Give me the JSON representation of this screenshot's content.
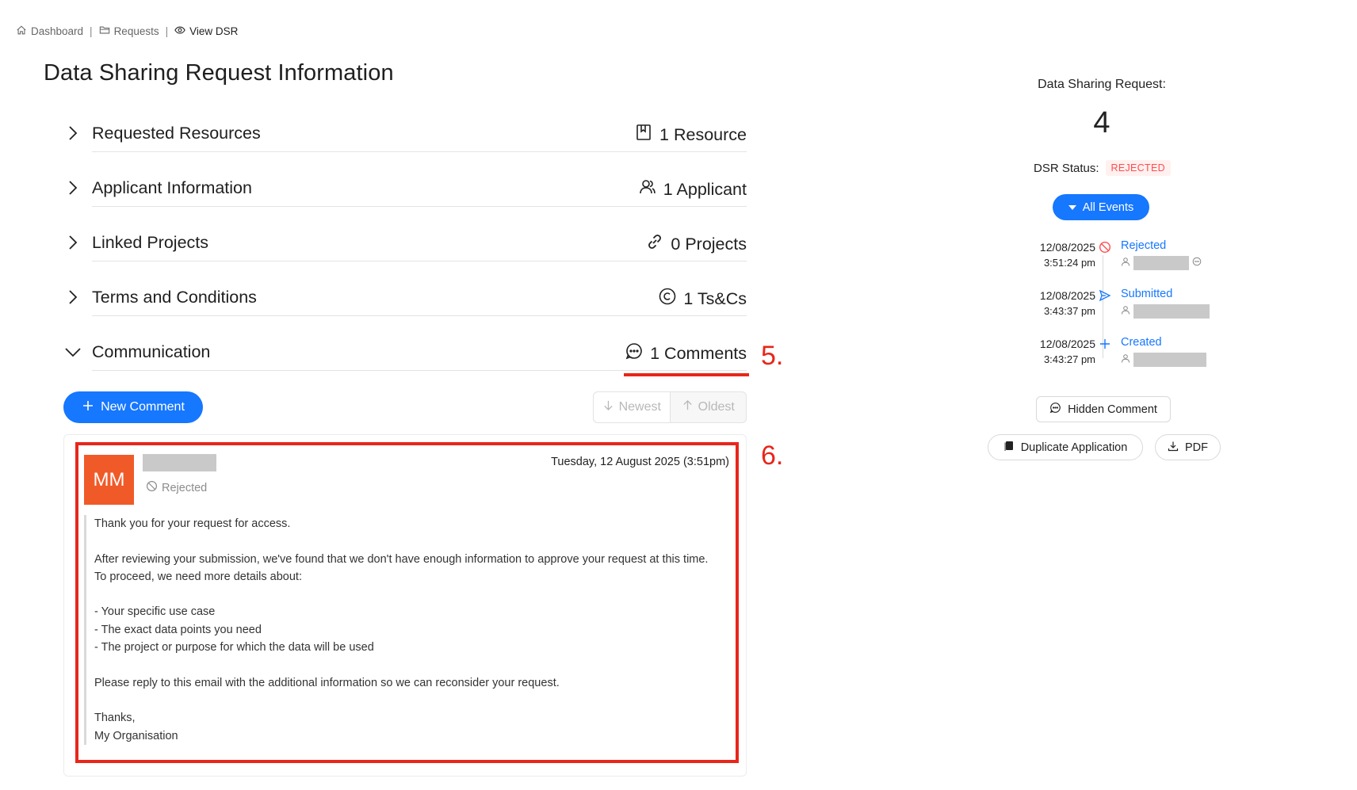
{
  "breadcrumb": {
    "items": [
      {
        "label": "Dashboard",
        "icon": "home-icon"
      },
      {
        "label": "Requests",
        "icon": "folder-icon"
      },
      {
        "label": "View DSR",
        "icon": "eye-icon"
      }
    ],
    "separator": "|"
  },
  "page_title": "Data Sharing Request Information",
  "sections": [
    {
      "title": "Requested Resources",
      "count": "1 Resource",
      "icon": "book-icon",
      "expanded": false
    },
    {
      "title": "Applicant Information",
      "count": "1 Applicant",
      "icon": "users-icon",
      "expanded": false
    },
    {
      "title": "Linked Projects",
      "count": "0 Projects",
      "icon": "link-icon",
      "expanded": false
    },
    {
      "title": "Terms and Conditions",
      "count": "1 Ts&Cs",
      "icon": "copyright-icon",
      "expanded": false
    },
    {
      "title": "Communication",
      "count": "1 Comments",
      "icon": "chat-icon",
      "expanded": true
    }
  ],
  "annotations": {
    "five": "5.",
    "six": "6."
  },
  "comments_toolbar": {
    "new_comment_label": "New Comment",
    "sort_newest_label": "Newest",
    "sort_oldest_label": "Oldest"
  },
  "comment": {
    "avatar_initials": "MM",
    "status": "Rejected",
    "date": "Tuesday, 12 August 2025 (3:51pm)",
    "body_lines": [
      "Thank you for your request for access.",
      "",
      "After reviewing your submission, we've found that we don't have enough information to approve your request at this time.",
      "To proceed, we need more details about:",
      "",
      "- Your specific use case",
      "- The exact data points you need",
      "- The project or purpose for which the data will be used",
      "",
      "Please reply to this email with the additional information so we can reconsider your request.",
      "",
      "Thanks,",
      "My Organisation"
    ]
  },
  "right_panel": {
    "request_label": "Data Sharing Request:",
    "request_number": "4",
    "status_label": "DSR Status:",
    "status_value": "REJECTED",
    "status_color": "#ff4d4f",
    "events_button_label": "All Events",
    "timeline": [
      {
        "date": "12/08/2025",
        "time": "3:51:24 pm",
        "event": "Rejected",
        "icon": "stop-icon",
        "icon_color": "#ff4d4f"
      },
      {
        "date": "12/08/2025",
        "time": "3:43:37 pm",
        "event": "Submitted",
        "icon": "send-icon",
        "icon_color": "#1677ff"
      },
      {
        "date": "12/08/2025",
        "time": "3:43:27 pm",
        "event": "Created",
        "icon": "plus-icon",
        "icon_color": "#1677ff"
      }
    ],
    "hidden_comment_label": "Hidden Comment",
    "duplicate_label": "Duplicate Application",
    "pdf_label": "PDF"
  },
  "colors": {
    "primary": "#1677ff",
    "annotation_red": "#e8261a",
    "avatar_bg": "#f05a28"
  }
}
